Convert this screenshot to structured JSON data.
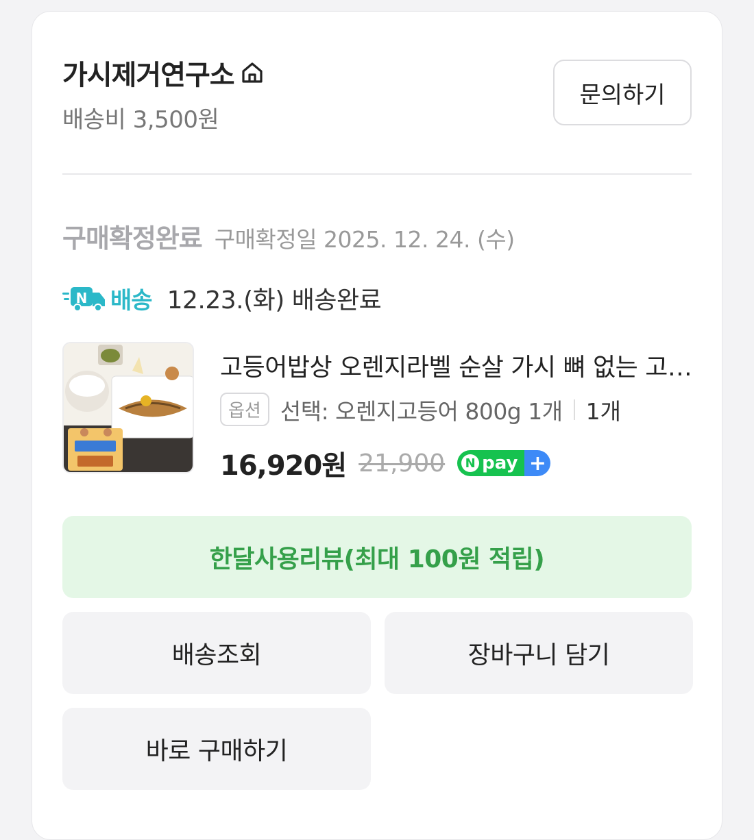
{
  "store": {
    "name": "가시제거연구소",
    "shipping_fee": "배송비 3,500원",
    "inquiry_label": "문의하기",
    "icon": "home-icon"
  },
  "order_status": {
    "title": "구매확정완료",
    "date": "구매확정일 2025. 12. 24. (수)"
  },
  "delivery": {
    "badge_label": "배송",
    "badge_color": "#2bb8c8",
    "text": "12.23.(화) 배송완료"
  },
  "product": {
    "name": "고등어밥상 오렌지라벨 순살 가시 뼈 없는 고등어",
    "option_tag": "옵션",
    "option_text": "선택: 오렌지고등어 800g 1개",
    "quantity": "1개",
    "price": "16,920원",
    "original_price": "21,900",
    "npay_label": "pay",
    "npay_n": "N",
    "npay_plus": "+"
  },
  "actions": {
    "review": "한달사용리뷰(최대 100원 적립)",
    "track": "배송조회",
    "cart": "장바구니 담기",
    "buy_now": "바로 구매하기"
  },
  "colors": {
    "review_bg": "#e4f7e6",
    "review_text": "#35a04a",
    "npay_green": "#16c24f",
    "npay_blue": "#3d8af7"
  }
}
